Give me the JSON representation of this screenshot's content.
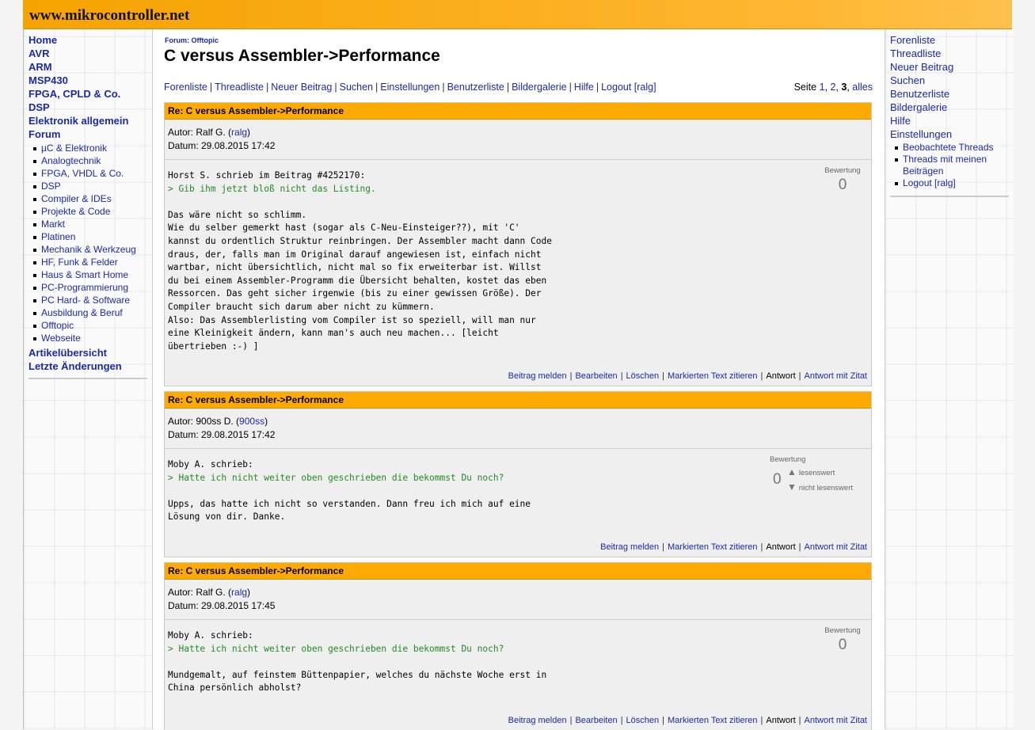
{
  "site": {
    "logo": "www.mikrocontroller.net"
  },
  "leftnav": {
    "main": [
      {
        "label": "Home"
      },
      {
        "label": "AVR"
      },
      {
        "label": "ARM"
      },
      {
        "label": "MSP430"
      },
      {
        "label": "FPGA, CPLD & Co."
      },
      {
        "label": "DSP"
      },
      {
        "label": "Elektronik allgemein"
      },
      {
        "label": "Forum"
      }
    ],
    "forum_sub": [
      "µC & Elektronik",
      "Analogtechnik",
      "FPGA, VHDL & Co.",
      "DSP",
      "Compiler & IDEs",
      "Projekte & Code",
      "Markt",
      "Platinen",
      "Mechanik & Werkzeug",
      "HF, Funk & Felder",
      "Haus & Smart Home",
      "PC-Programmierung",
      "PC Hard- & Software",
      "Ausbildung & Beruf",
      "Offtopic",
      "Webseite"
    ],
    "after": [
      {
        "label": "Artikelübersicht"
      },
      {
        "label": "Letzte Änderungen"
      }
    ]
  },
  "rightnav": {
    "main": [
      "Forenliste",
      "Threadliste",
      "Neuer Beitrag",
      "Suchen",
      "Benutzerliste",
      "Bildergalerie",
      "Hilfe",
      "Einstellungen"
    ],
    "sub": [
      "Beobachtete Threads",
      "Threads mit meinen Beiträgen",
      "Logout [ralg]"
    ]
  },
  "content": {
    "forum_label": "Forum: Offtopic",
    "title": "C versus Assembler->Performance",
    "topnav": [
      "Forenliste",
      "Threadliste",
      "Neuer Beitrag",
      "Suchen",
      "Einstellungen",
      "Benutzerliste",
      "Bildergalerie",
      "Hilfe",
      "Logout [ralg]"
    ],
    "pages": {
      "prefix": "Seite",
      "p1": "1",
      "p2": "2",
      "p3": "3",
      "all": "alles"
    }
  },
  "posts": [
    {
      "title": "Re: C versus Assembler->Performance",
      "author_prefix": "Autor: Ralf G. (",
      "author_link": "ralg",
      "author_suffix": ")",
      "date": "Datum: 29.08.2015 17:42",
      "rating_label": "Bewertung",
      "rating_value": "0",
      "lines": [
        {
          "q": false,
          "t": "Horst S. schrieb im Beitrag #4252170:"
        },
        {
          "q": true,
          "t": "> Gib ihm jetzt bloß nicht das Listing."
        },
        {
          "q": false,
          "t": ""
        },
        {
          "q": false,
          "t": "Das wäre nicht so schlimm."
        },
        {
          "q": false,
          "t": "Wie du selber gemerkt hast (sogar als C-Neu-Einsteiger??), mit 'C'"
        },
        {
          "q": false,
          "t": "kannst du ordentlich Struktur reinbringen. Der Assembler macht dann Code"
        },
        {
          "q": false,
          "t": "draus, der, falls man im Original darauf angewiesen ist, einfach nicht"
        },
        {
          "q": false,
          "t": "wartbar, nicht übersichtlich, nicht mal so fix erweiterbar ist. Willst"
        },
        {
          "q": false,
          "t": "du bei einem Assembler-Programm die Übersicht behalten, kostet das eben"
        },
        {
          "q": false,
          "t": "Ressorcen. Das geht sicher irgenwie (bis zu einer gewissen Größe). Der"
        },
        {
          "q": false,
          "t": "Compiler braucht sich darum aber nicht zu kümmern."
        },
        {
          "q": false,
          "t": "Also: Das Assemblerlisting vom Compiler ist so speziell, will man nur"
        },
        {
          "q": false,
          "t": "eine Kleinigkeit ändern, kann man's auch neu machen... [leicht"
        },
        {
          "q": false,
          "t": "übertrieben :-) ]"
        }
      ],
      "actions": [
        "Beitrag melden",
        "Bearbeiten",
        "Löschen",
        "Markierten Text zitieren",
        "Antwort",
        "Antwort mit Zitat"
      ]
    },
    {
      "title": "Re: C versus Assembler->Performance",
      "author_prefix": "Autor: 900ss D. (",
      "author_link": "900ss",
      "author_suffix": ")",
      "date": "Datum: 29.08.2015 17:42",
      "rating_label": "Bewertung",
      "rating_value": "0",
      "vote_up": "lesenswert",
      "vote_down": "nicht lesenswert",
      "lines": [
        {
          "q": false,
          "t": "Moby A. schrieb:"
        },
        {
          "q": true,
          "t": "> Hatte ich nicht weiter oben geschrieben die bekommst Du noch?"
        },
        {
          "q": false,
          "t": ""
        },
        {
          "q": false,
          "t": "Upps, das hatte ich nicht so verstanden. Dann freu ich mich auf eine"
        },
        {
          "q": false,
          "t": "Lösung von dir. Danke."
        }
      ],
      "actions": [
        "Beitrag melden",
        "Markierten Text zitieren",
        "Antwort",
        "Antwort mit Zitat"
      ]
    },
    {
      "title": "Re: C versus Assembler->Performance",
      "author_prefix": "Autor: Ralf G. (",
      "author_link": "ralg",
      "author_suffix": ")",
      "date": "Datum: 29.08.2015 17:45",
      "rating_label": "Bewertung",
      "rating_value": "0",
      "lines": [
        {
          "q": false,
          "t": "Moby A. schrieb:"
        },
        {
          "q": true,
          "t": "> Hatte ich nicht weiter oben geschrieben die bekommst Du noch?"
        },
        {
          "q": false,
          "t": ""
        },
        {
          "q": false,
          "t": "Mundgemalt, auf feinstem Büttenpapier, welches du nächste Woche erst in"
        },
        {
          "q": false,
          "t": "China persönlich abholst?"
        }
      ],
      "actions": [
        "Beitrag melden",
        "Bearbeiten",
        "Löschen",
        "Markierten Text zitieren",
        "Antwort",
        "Antwort mit Zitat"
      ]
    }
  ]
}
